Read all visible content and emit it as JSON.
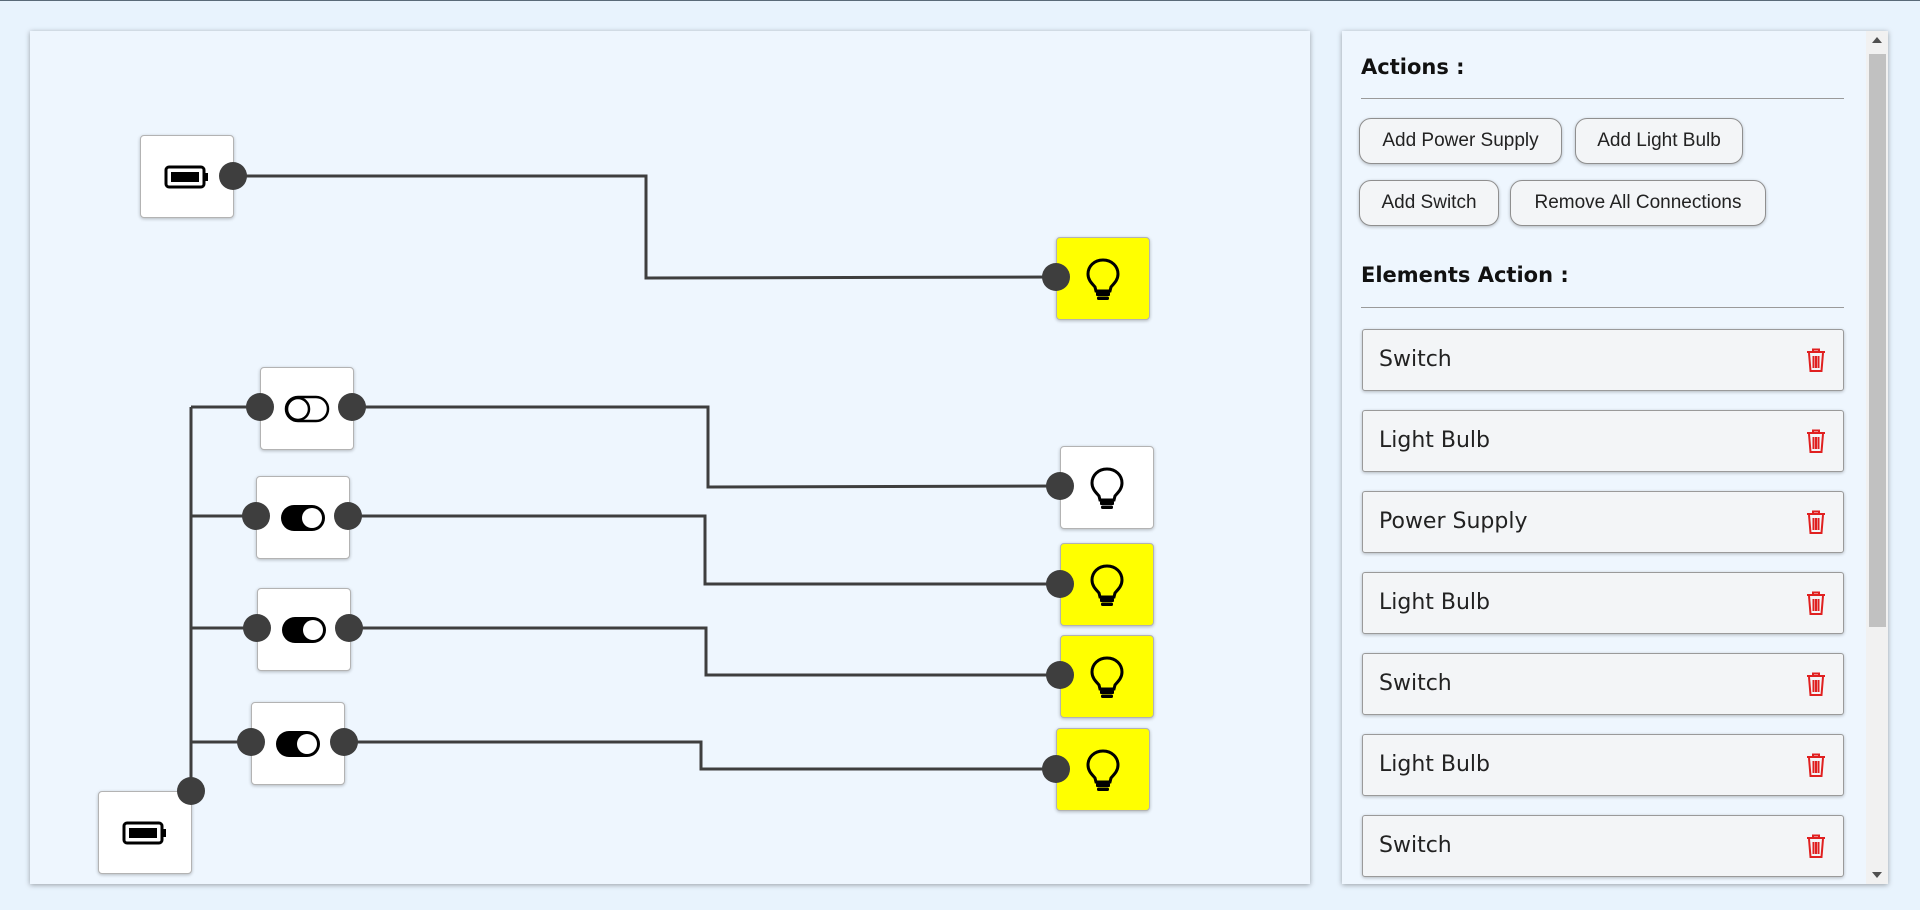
{
  "panel": {
    "actions_title": "Actions :",
    "buttons": {
      "add_power_supply": "Add Power Supply",
      "add_light_bulb": "Add Light Bulb",
      "add_switch": "Add Switch",
      "remove_all_connections": "Remove All Connections"
    },
    "elements_title": "Elements Action :",
    "elements": [
      {
        "label": "Switch",
        "icon": "trash-icon"
      },
      {
        "label": "Light Bulb",
        "icon": "trash-icon"
      },
      {
        "label": "Power Supply",
        "icon": "trash-icon"
      },
      {
        "label": "Light Bulb",
        "icon": "trash-icon"
      },
      {
        "label": "Switch",
        "icon": "trash-icon"
      },
      {
        "label": "Light Bulb",
        "icon": "trash-icon"
      },
      {
        "label": "Switch",
        "icon": "trash-icon"
      }
    ]
  },
  "canvas": {
    "power_supplies": [
      {
        "icon": "battery-icon"
      },
      {
        "icon": "battery-icon"
      }
    ],
    "switches": [
      {
        "state": "off",
        "icon": "toggle-off-icon"
      },
      {
        "state": "on",
        "icon": "toggle-on-icon"
      },
      {
        "state": "on",
        "icon": "toggle-on-icon"
      },
      {
        "state": "on",
        "icon": "toggle-on-icon"
      }
    ],
    "bulbs": [
      {
        "lit": true,
        "icon": "lightbulb-icon"
      },
      {
        "lit": false,
        "icon": "lightbulb-icon"
      },
      {
        "lit": true,
        "icon": "lightbulb-icon"
      },
      {
        "lit": true,
        "icon": "lightbulb-icon"
      },
      {
        "lit": true,
        "icon": "lightbulb-icon"
      }
    ]
  },
  "colors": {
    "lit_bulb": "#ffff00",
    "wire": "#3e3e3e",
    "delete_icon": "#e02020"
  }
}
